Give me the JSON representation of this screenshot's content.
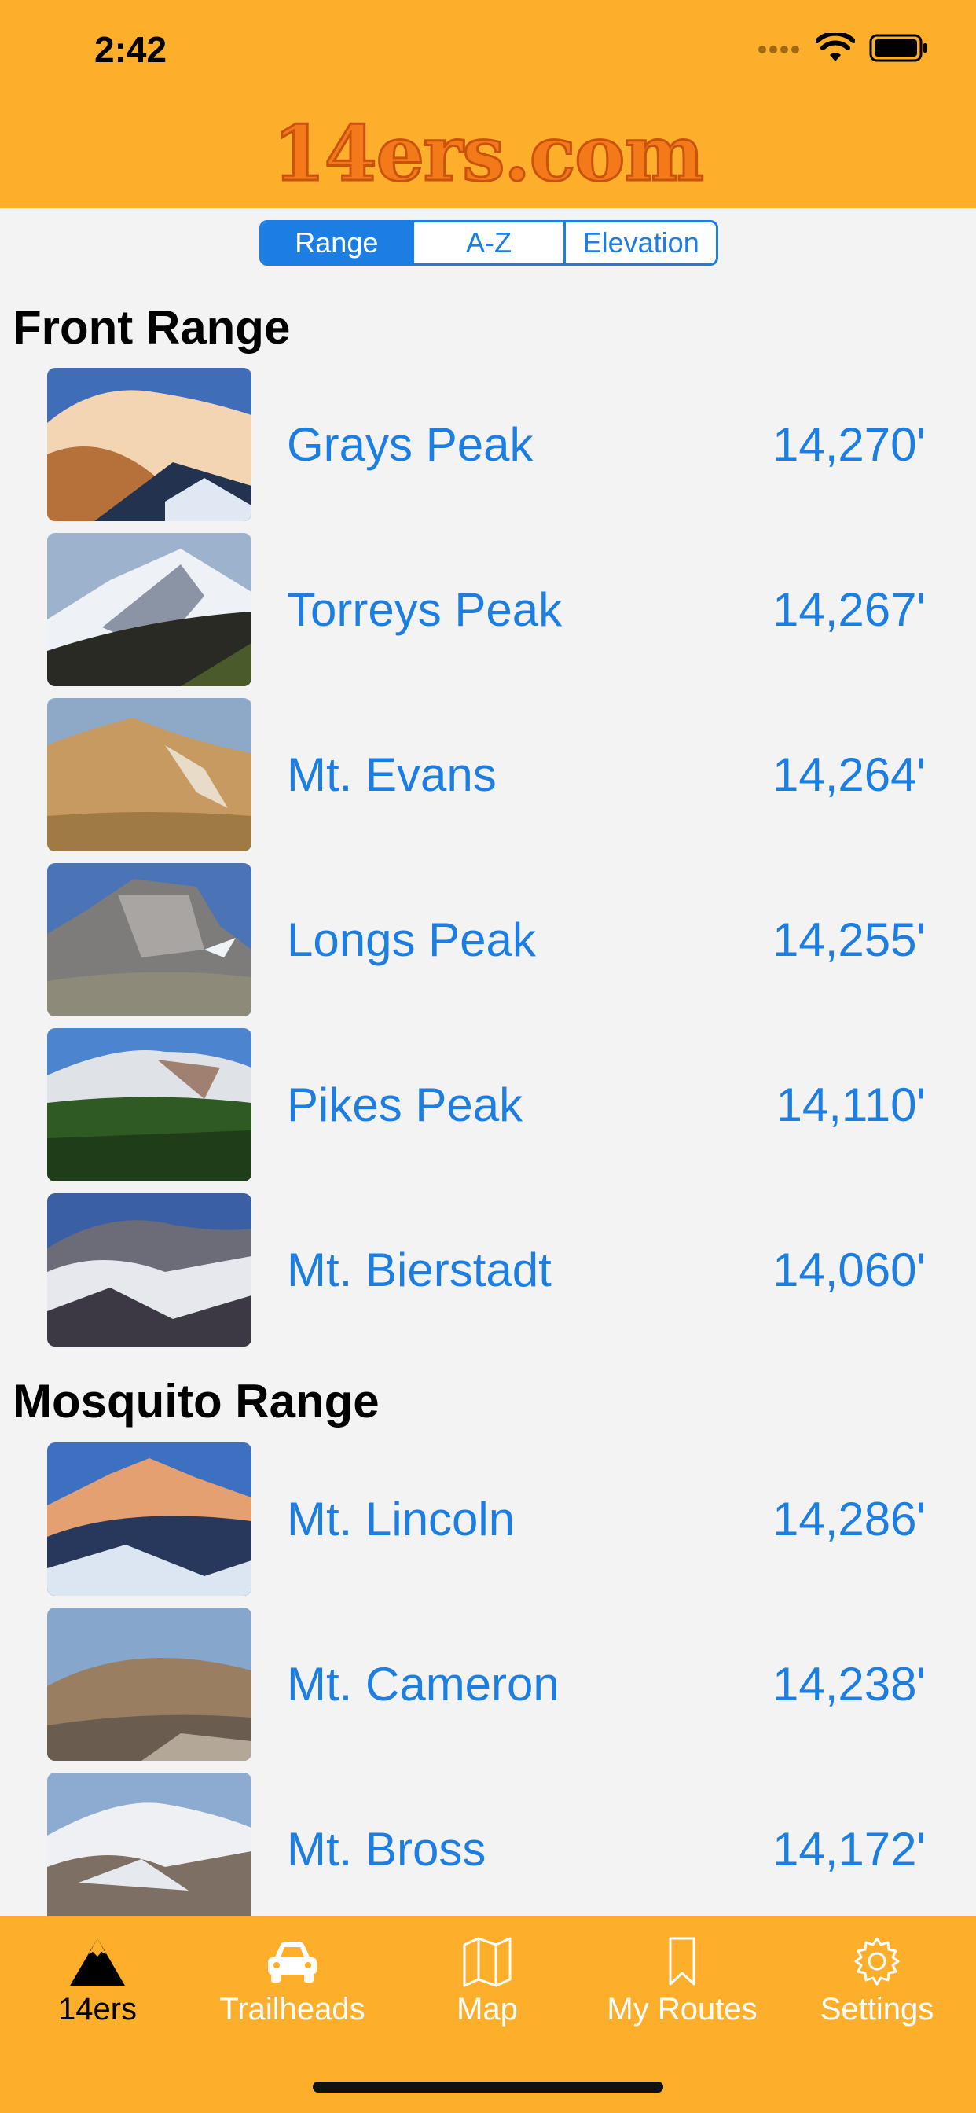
{
  "status": {
    "time": "2:42"
  },
  "header": {
    "logo": "14ers.com"
  },
  "segments": [
    "Range",
    "A-Z",
    "Elevation"
  ],
  "sections": [
    {
      "title": "Front Range",
      "peaks": [
        {
          "name": "Grays Peak",
          "elevation": "14,270'"
        },
        {
          "name": "Torreys Peak",
          "elevation": "14,267'"
        },
        {
          "name": "Mt. Evans",
          "elevation": "14,264'"
        },
        {
          "name": "Longs Peak",
          "elevation": "14,255'"
        },
        {
          "name": "Pikes Peak",
          "elevation": "14,110'"
        },
        {
          "name": "Mt. Bierstadt",
          "elevation": "14,060'"
        }
      ]
    },
    {
      "title": "Mosquito Range",
      "peaks": [
        {
          "name": "Mt. Lincoln",
          "elevation": "14,286'"
        },
        {
          "name": "Mt. Cameron",
          "elevation": "14,238'"
        },
        {
          "name": "Mt. Bross",
          "elevation": "14,172'"
        }
      ]
    }
  ],
  "tabs": [
    {
      "label": "14ers",
      "icon": "mountain-icon"
    },
    {
      "label": "Trailheads",
      "icon": "car-icon"
    },
    {
      "label": "Map",
      "icon": "map-icon"
    },
    {
      "label": "My Routes",
      "icon": "bookmark-icon"
    },
    {
      "label": "Settings",
      "icon": "gear-icon"
    }
  ],
  "colors": {
    "accent": "#1c7ee3",
    "header": "#fdaf2c",
    "logo": "#f47a19"
  }
}
